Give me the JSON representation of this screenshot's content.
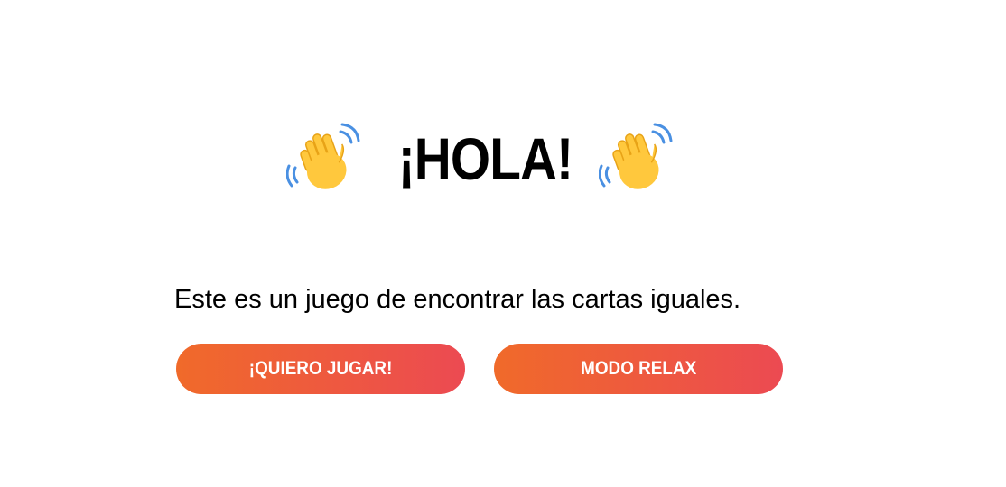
{
  "hero": {
    "title": "¡HOLA!",
    "left_icon": "waving-hand-icon",
    "right_icon": "waving-hand-icon"
  },
  "intro": {
    "text": "Este es un juego de encontrar las cartas iguales."
  },
  "buttons": {
    "play_label": "¡QUIERO JUGAR!",
    "relax_label": "MODO RELAX"
  },
  "colors": {
    "button_gradient_start": "#f06a2a",
    "button_gradient_end": "#ec4a52",
    "button_text": "#ffffff",
    "hand": "#ffc83d",
    "wave_lines": "#4a90e2"
  }
}
